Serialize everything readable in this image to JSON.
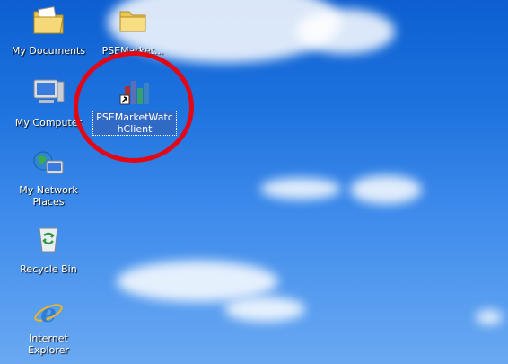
{
  "desktop": {
    "icons": [
      {
        "label": "My Documents",
        "icon": "my-documents-icon"
      },
      {
        "label": "PSEMarket...",
        "icon": "folder-icon"
      },
      {
        "label": "My Computer",
        "icon": "my-computer-icon"
      },
      {
        "label": "PSEMarketWatchClient",
        "icon": "chart-shortcut-icon",
        "selected": true
      },
      {
        "label": "My Network Places",
        "icon": "network-places-icon"
      },
      {
        "label": "Recycle Bin",
        "icon": "recycle-bin-icon"
      },
      {
        "label": "Internet Explorer",
        "icon": "internet-explorer-icon"
      }
    ],
    "highlight_color": "#e30613",
    "selection_color": "#316ac5"
  }
}
